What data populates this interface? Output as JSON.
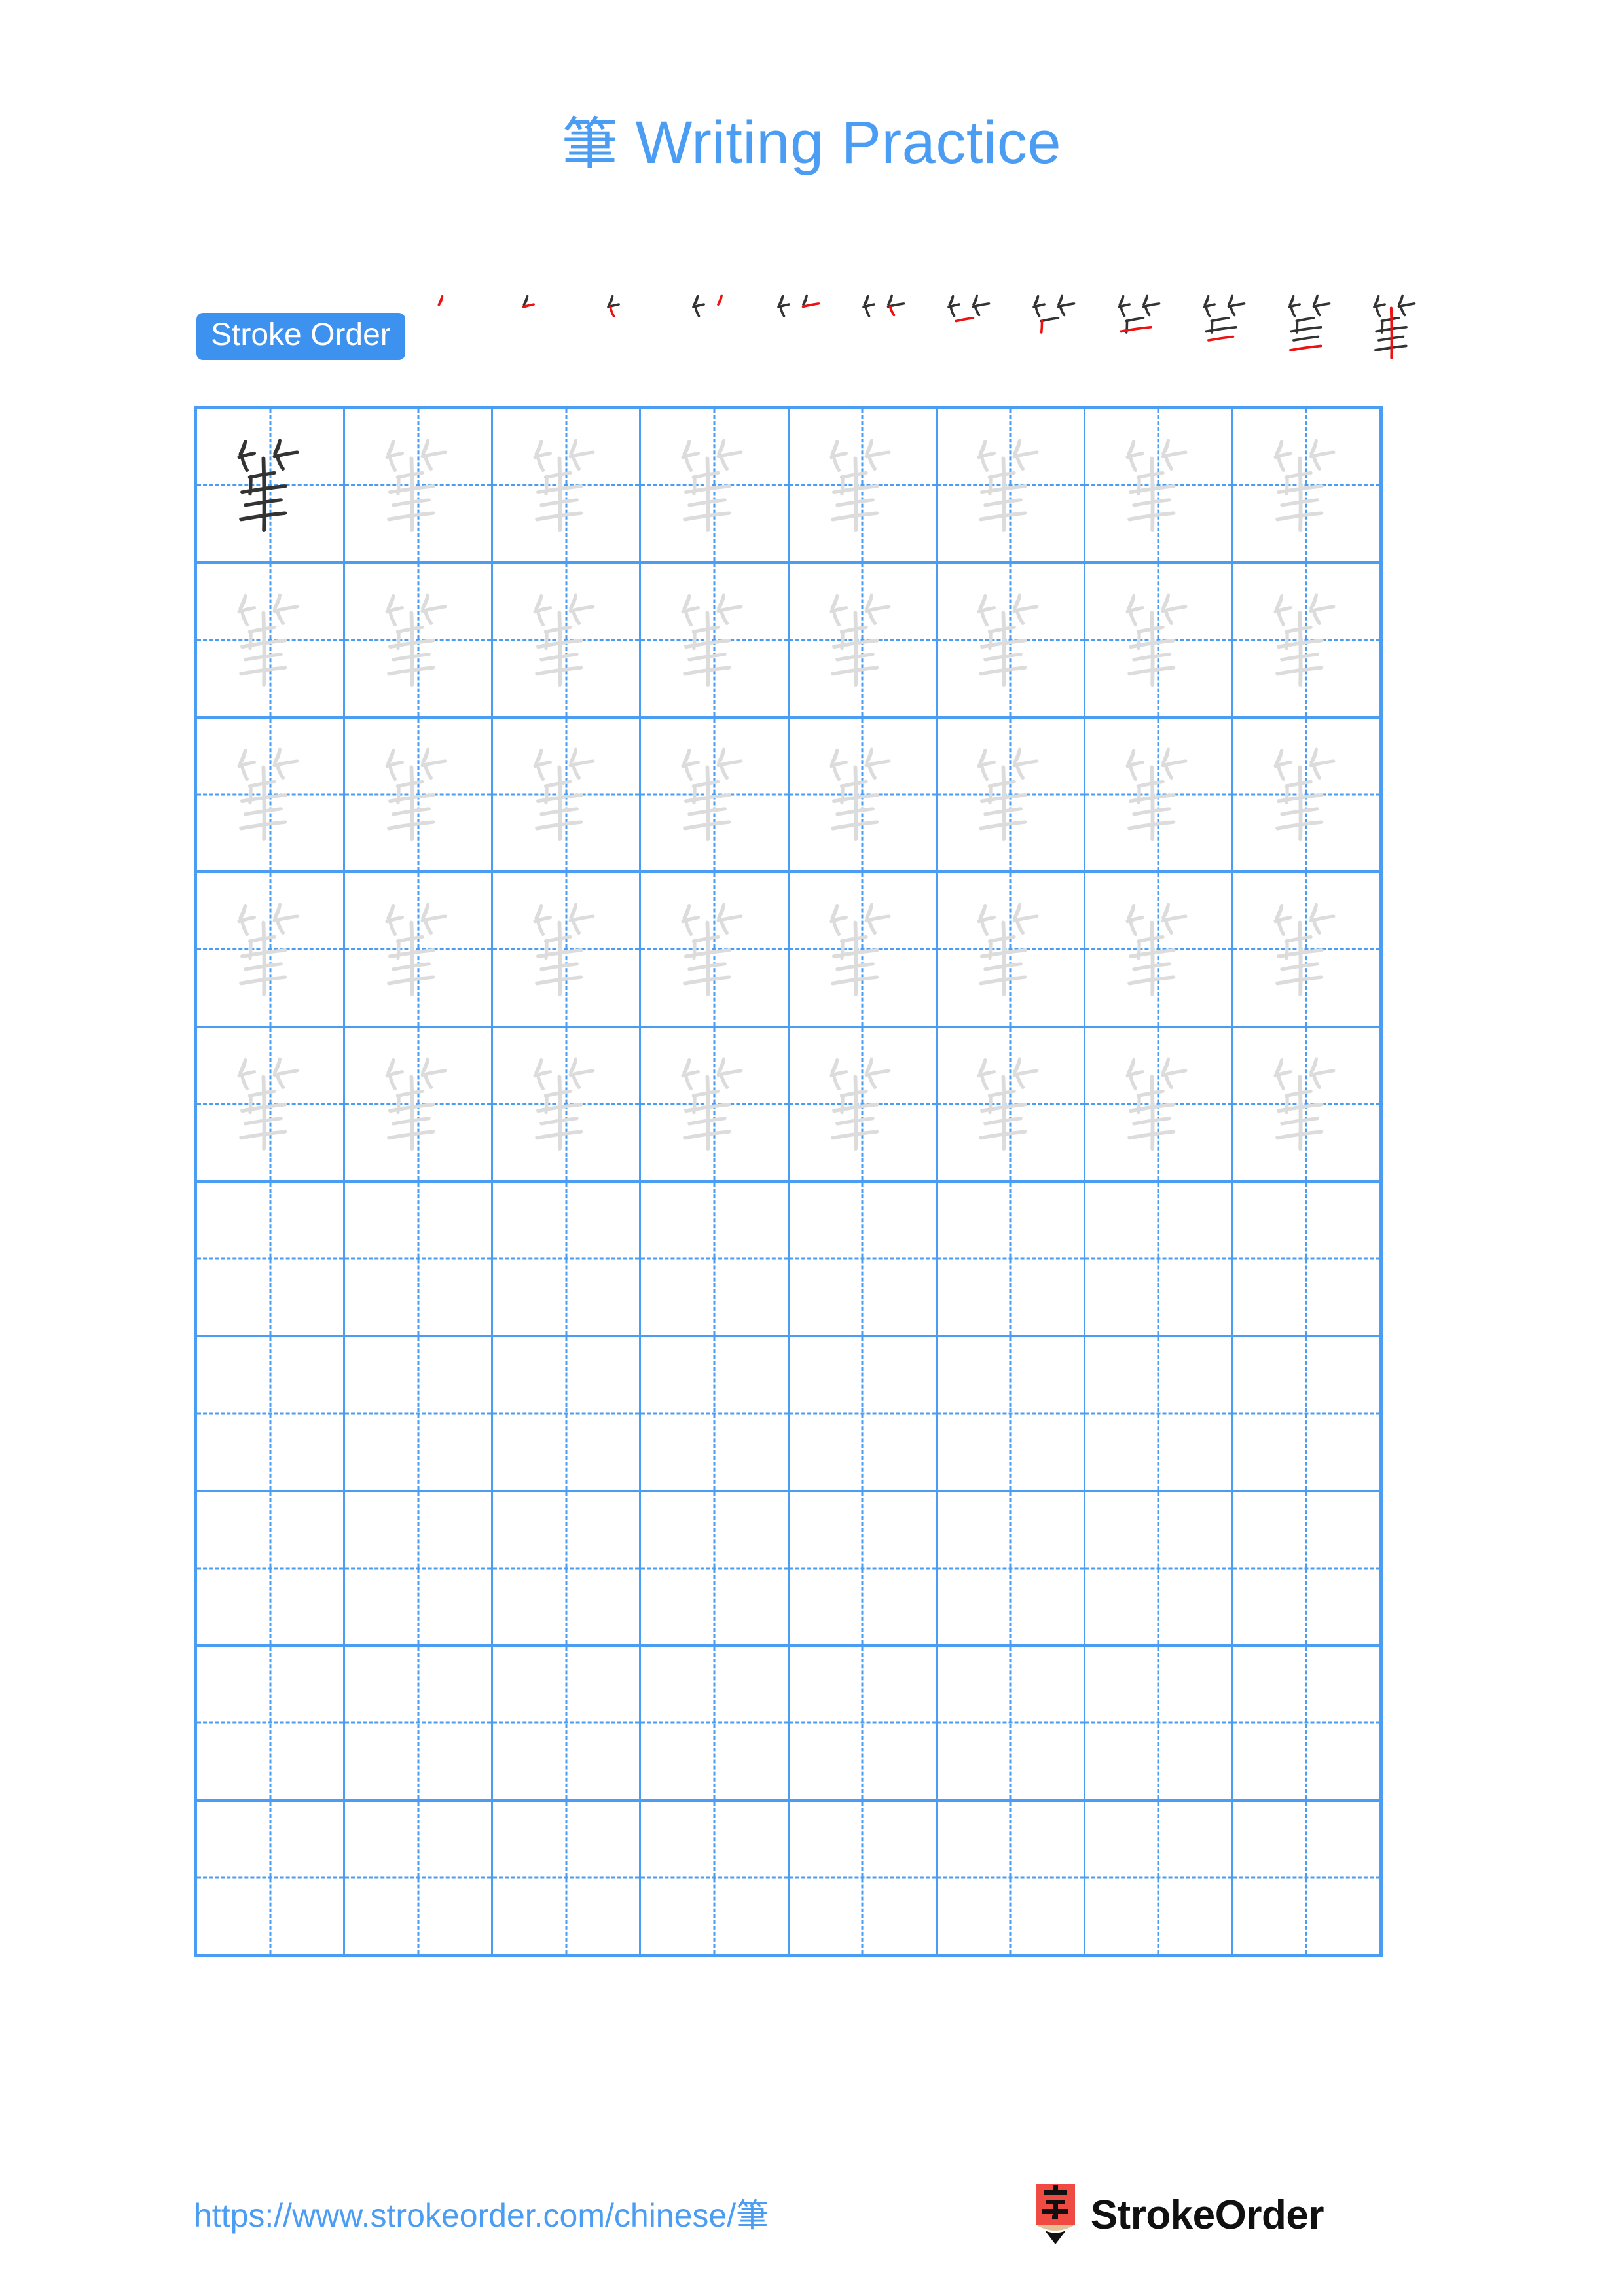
{
  "page": {
    "character": "筆",
    "background_color": "#ffffff"
  },
  "header": {
    "title_character": "筆",
    "title_text": " Writing Practice",
    "title_color": "#4a9df2"
  },
  "stroke_order": {
    "badge_label": "Stroke Order",
    "badge_bg_color": "#3d92f0",
    "badge_text_color": "#ffffff",
    "stroke_count": 12,
    "new_stroke_color": "#ee1111",
    "existing_stroke_color": "#333333",
    "steps": [
      {
        "index": 1,
        "strokes_shown": 1
      },
      {
        "index": 2,
        "strokes_shown": 2
      },
      {
        "index": 3,
        "strokes_shown": 3
      },
      {
        "index": 4,
        "strokes_shown": 4
      },
      {
        "index": 5,
        "strokes_shown": 5
      },
      {
        "index": 6,
        "strokes_shown": 6
      },
      {
        "index": 7,
        "strokes_shown": 7
      },
      {
        "index": 8,
        "strokes_shown": 8
      },
      {
        "index": 9,
        "strokes_shown": 9
      },
      {
        "index": 10,
        "strokes_shown": 10
      },
      {
        "index": 11,
        "strokes_shown": 11
      },
      {
        "index": 12,
        "strokes_shown": 12
      }
    ]
  },
  "practice_grid": {
    "columns": 8,
    "rows": 10,
    "grid_line_color": "#4a9df2",
    "traced_char_color": "#333333",
    "faded_char_color": "#dcdcdc",
    "rows_data": [
      {
        "row": 1,
        "cells": [
          "dark",
          "faded",
          "faded",
          "faded",
          "faded",
          "faded",
          "faded",
          "faded"
        ]
      },
      {
        "row": 2,
        "cells": [
          "faded",
          "faded",
          "faded",
          "faded",
          "faded",
          "faded",
          "faded",
          "faded"
        ]
      },
      {
        "row": 3,
        "cells": [
          "faded",
          "faded",
          "faded",
          "faded",
          "faded",
          "faded",
          "faded",
          "faded"
        ]
      },
      {
        "row": 4,
        "cells": [
          "faded",
          "faded",
          "faded",
          "faded",
          "faded",
          "faded",
          "faded",
          "faded"
        ]
      },
      {
        "row": 5,
        "cells": [
          "faded",
          "faded",
          "faded",
          "faded",
          "faded",
          "faded",
          "faded",
          "faded"
        ]
      },
      {
        "row": 6,
        "cells": [
          "empty",
          "empty",
          "empty",
          "empty",
          "empty",
          "empty",
          "empty",
          "empty"
        ]
      },
      {
        "row": 7,
        "cells": [
          "empty",
          "empty",
          "empty",
          "empty",
          "empty",
          "empty",
          "empty",
          "empty"
        ]
      },
      {
        "row": 8,
        "cells": [
          "empty",
          "empty",
          "empty",
          "empty",
          "empty",
          "empty",
          "empty",
          "empty"
        ]
      },
      {
        "row": 9,
        "cells": [
          "empty",
          "empty",
          "empty",
          "empty",
          "empty",
          "empty",
          "empty",
          "empty"
        ]
      },
      {
        "row": 10,
        "cells": [
          "empty",
          "empty",
          "empty",
          "empty",
          "empty",
          "empty",
          "empty",
          "empty"
        ]
      }
    ]
  },
  "footer": {
    "url": "https://www.strokeorder.com/chinese/筆",
    "url_prefix": "https://www.strokeorder.com/chinese/",
    "url_character": "筆",
    "url_color": "#4a9df2",
    "brand_name": "StrokeOrder",
    "logo_character": "字",
    "logo_body_color": "#ef4b42",
    "logo_wood_color": "#e3c195",
    "logo_tip_color": "#101010"
  }
}
